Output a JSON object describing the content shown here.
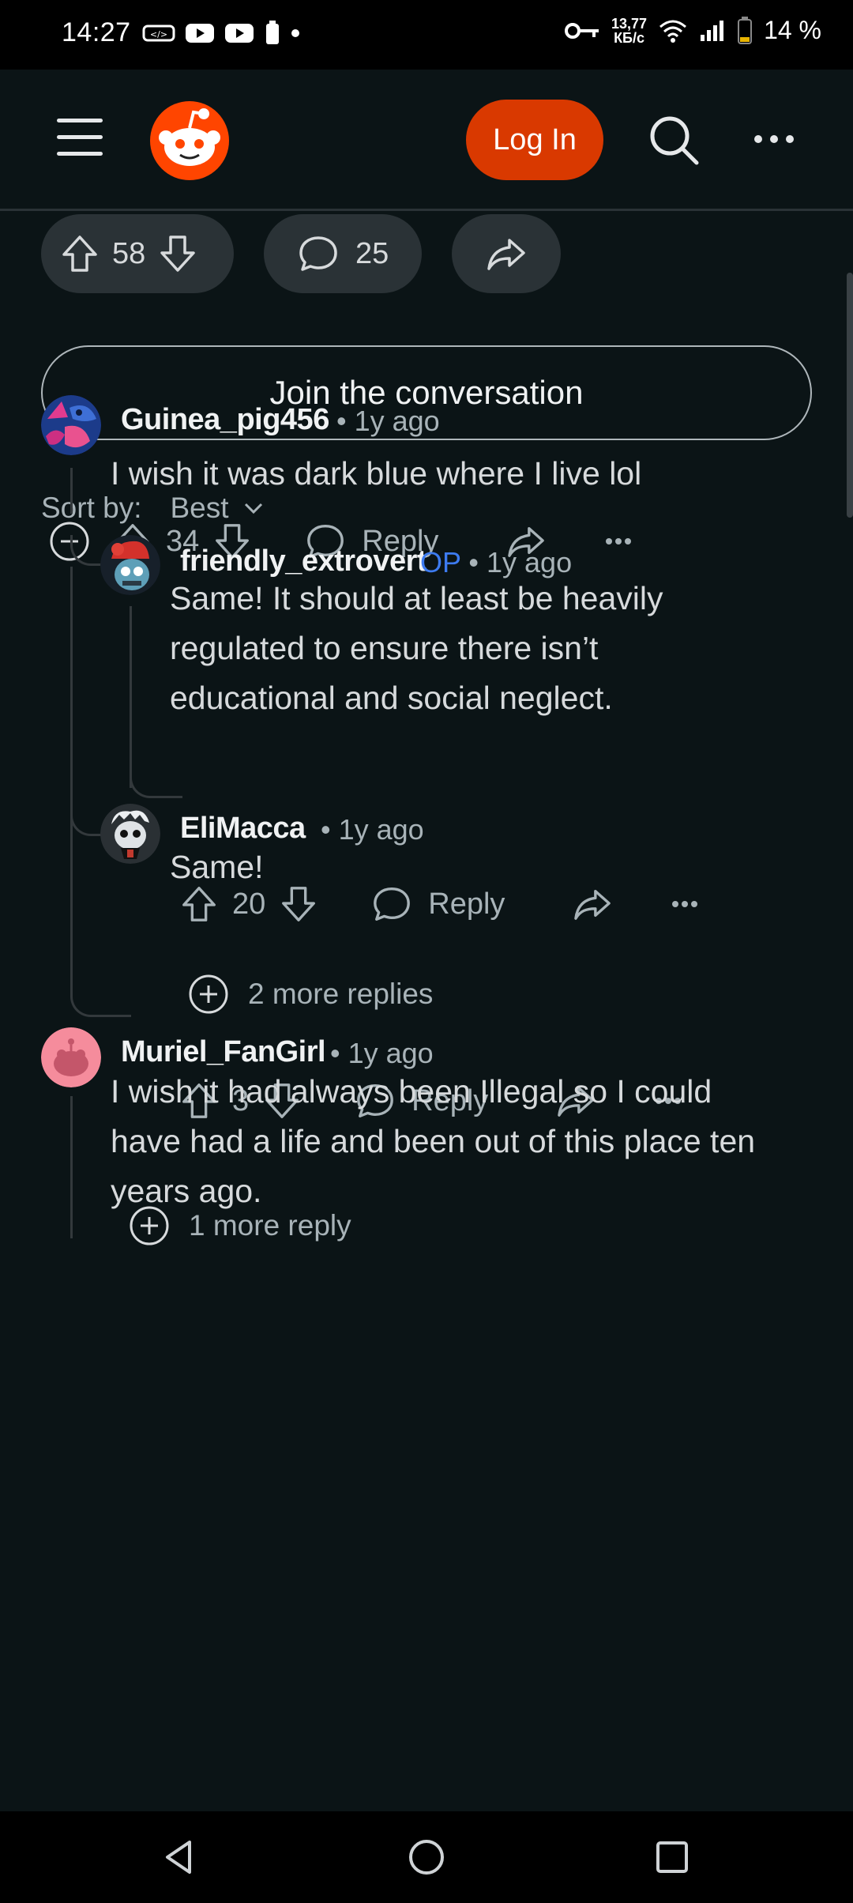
{
  "status": {
    "time": "14:27",
    "net_speed_top": "13,77",
    "net_speed_unit": "КБ/с",
    "battery": "14 %"
  },
  "header": {
    "login_label": "Log In"
  },
  "post_actions": {
    "votes": "58",
    "comments": "25"
  },
  "join_label": "Join the conversation",
  "sort": {
    "label": "Sort by:",
    "value": "Best"
  },
  "comments": [
    {
      "user": "Guinea_pig456",
      "meta": "• 1y ago",
      "text": "I wish it was dark blue where I live lol",
      "votes": "34",
      "reply": "Reply"
    },
    {
      "user": "friendly_extrovert",
      "op": "OP",
      "meta": "• 1y ago",
      "text_lines": [
        "Same! It should at least be heavily",
        "regulated to ensure there isn’t",
        "educational and social neglect."
      ],
      "votes": "20",
      "reply": "Reply",
      "more": "2 more replies"
    },
    {
      "user": "EliMacca",
      "meta": "• 1y ago",
      "text": "Same!",
      "votes": "3",
      "reply": "Reply"
    },
    {
      "more": "1 more reply"
    },
    {
      "user": "Muriel_FanGirl",
      "meta": "• 1y ago",
      "text_lines": [
        "I wish it had always been Illegal so I could",
        "have had a life and been out of this place ten",
        "years ago."
      ]
    }
  ],
  "colors": {
    "accent": "#d93900",
    "op_blue": "#3d7bf0",
    "background": "#0b1416"
  }
}
